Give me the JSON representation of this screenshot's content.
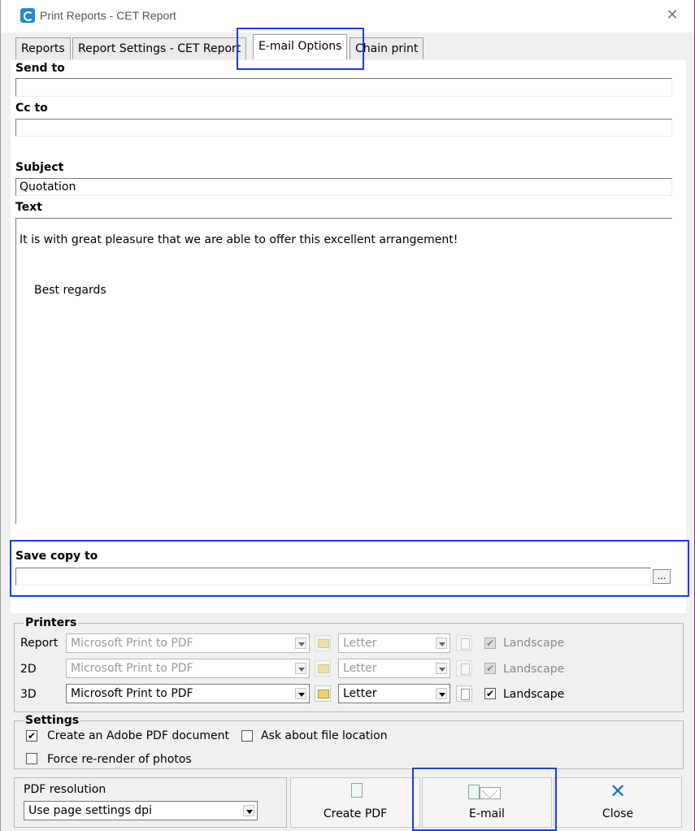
{
  "window": {
    "title": "Print Reports - CET Report",
    "close_glyph": "✕"
  },
  "tabs": [
    {
      "label": "Reports"
    },
    {
      "label": "Report Settings - CET Report"
    },
    {
      "label": "E-mail Options"
    },
    {
      "label": "Chain print"
    }
  ],
  "email": {
    "send_to_label": "Send to",
    "send_to_value": "",
    "cc_label": "Cc to",
    "cc_value": "",
    "subject_label": "Subject",
    "subject_value": "Quotation",
    "text_label": "Text",
    "text_line1": "It is with great pleasure that we are able to offer this excellent arrangement!",
    "text_line2": "Best regards",
    "save_copy_label": "Save copy to",
    "save_copy_value": "",
    "browse_label": "..."
  },
  "printers": {
    "title": "Printers",
    "rows": [
      {
        "label": "Report",
        "printer": "Microsoft Print to PDF",
        "paper": "Letter",
        "landscape_label": "Landscape",
        "landscape": true,
        "enabled": false
      },
      {
        "label": "2D",
        "printer": "Microsoft Print to PDF",
        "paper": "Letter",
        "landscape_label": "Landscape",
        "landscape": true,
        "enabled": false
      },
      {
        "label": "3D",
        "printer": "Microsoft Print to PDF",
        "paper": "Letter",
        "landscape_label": "Landscape",
        "landscape": true,
        "enabled": true
      }
    ]
  },
  "settings": {
    "title": "Settings",
    "create_pdf_label": "Create an Adobe PDF document",
    "create_pdf_checked": true,
    "ask_location_label": "Ask about file location",
    "ask_location_checked": false,
    "force_render_label": "Force re-render of photos",
    "force_render_checked": false
  },
  "pdf_resolution": {
    "title": "PDF resolution",
    "value": "Use page settings dpi"
  },
  "buttons": {
    "create_pdf": "Create PDF",
    "email": "E-mail",
    "close": "Close"
  },
  "colors": {
    "highlight": "#1a3fe6",
    "accent_icon": "#1e6fd6"
  }
}
